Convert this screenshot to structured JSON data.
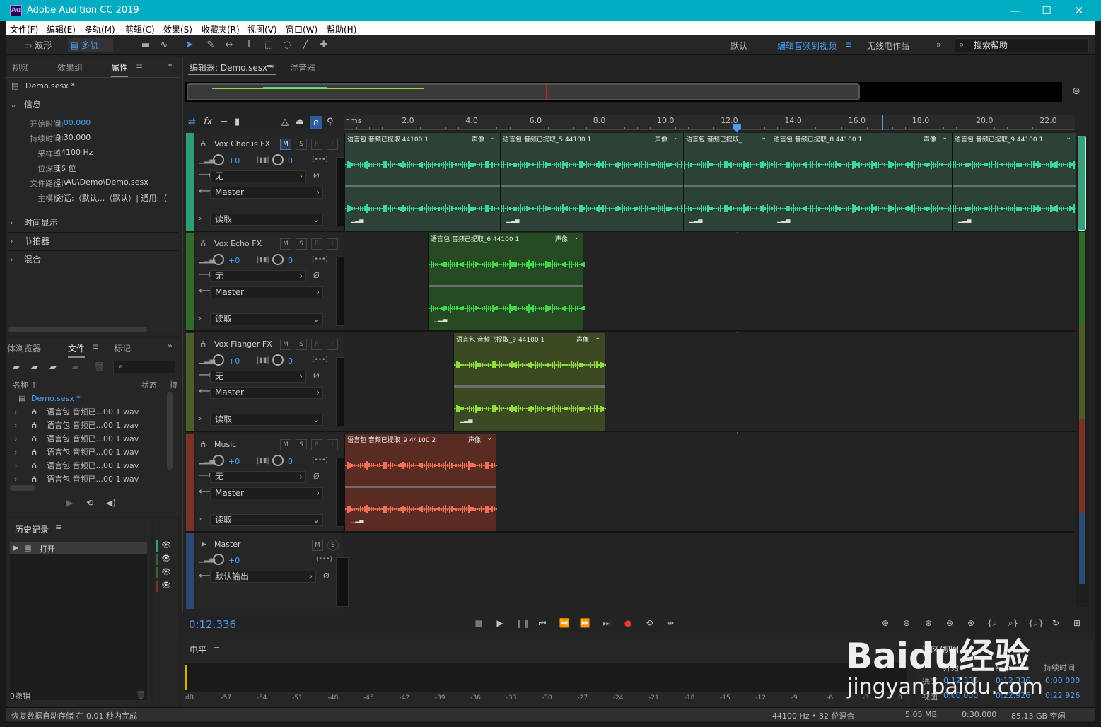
{
  "app": {
    "icon": "Au",
    "title": "Adobe Audition CC 2019"
  },
  "window_controls": {
    "minimize": "—",
    "maximize": "☐",
    "close": "✕"
  },
  "menu": [
    "文件(F)",
    "编辑(E)",
    "多轨(M)",
    "剪辑(C)",
    "效果(S)",
    "收藏夹(R)",
    "视图(V)",
    "窗口(W)",
    "帮助(H)"
  ],
  "toolbar": {
    "waveform": "波形",
    "multitrack": "多轨",
    "workspaces": [
      "默认",
      "编辑音频到视频",
      "无线电作品"
    ],
    "active_workspace_index": 1,
    "more": "»",
    "search_placeholder": "搜索帮助"
  },
  "left_panel": {
    "tabs": [
      "视频",
      "效果组",
      "属性"
    ],
    "active_tab": "属性",
    "more": "»",
    "file_title": "Demo.sesx *",
    "info_section": "信息",
    "info": [
      {
        "label": "开始时间:",
        "value": "0:00.000"
      },
      {
        "label": "持续时间:",
        "value": "0:30.000"
      },
      {
        "label": "采样率:",
        "value": "44100 Hz"
      },
      {
        "label": "位深度:",
        "value": "16 位"
      },
      {
        "label": "文件路径:",
        "value": "E:\\AU\\Demo\\Demo.sesx"
      },
      {
        "label": "主模板:",
        "value": "对话:（默认...（默认）| 通用:（"
      }
    ],
    "sections": [
      "时间显示",
      "节拍器",
      "混合"
    ]
  },
  "files_panel": {
    "tabs": [
      "体浏览器",
      "文件",
      "标记"
    ],
    "active_tab": "文件",
    "more": "»",
    "search_icon": "⌕",
    "col_name": "名称 ↑",
    "col_status": "状态",
    "col_extra": "持",
    "items": [
      "Demo.sesx *",
      "语言包 音频已...00 1.wav",
      "语言包 音频已...00 1.wav",
      "语言包 音频已...00 1.wav",
      "语言包 音频已...00 1.wav",
      "语言包 音频已...00 1.wav",
      "语言包 音频已...00 1.wav"
    ]
  },
  "history_panel": {
    "title": "历史记录",
    "items": [
      "打开"
    ],
    "undo": "0撤销"
  },
  "editor": {
    "tabs": [
      "编辑器: Demo.sesx *",
      "混音器"
    ],
    "ruler_label": "hms",
    "ruler_ticks": [
      "2.0",
      "4.0",
      "6.0",
      "8.0",
      "10.0",
      "12.0",
      "14.0",
      "16.0",
      "18.0",
      "20.0",
      "22.0"
    ],
    "playhead_time": 12.336,
    "tracks": [
      {
        "name": "Vox Chorus FX",
        "vol": "+0",
        "pan": "0",
        "input": "无",
        "output": "Master",
        "mode": "读取",
        "color": "#2e9e76",
        "clips": [
          {
            "label": "语言包 音频已提取 44100 1",
            "mono": "声像",
            "start": 0,
            "end": 4.88,
            "wave": "#3dd69a",
            "bg": "#2d4236"
          },
          {
            "label": "语言包 音频已提取_5 44100 1",
            "mono": "声像",
            "start": 4.88,
            "end": 10.62,
            "wave": "#3dd69a",
            "bg": "#2d4236"
          },
          {
            "label": "语言包 音频已提取_...",
            "mono": "",
            "start": 10.62,
            "end": 13.36,
            "wave": "#3dd69a",
            "bg": "#2d4236"
          },
          {
            "label": "语言包 音频已提取_8 44100 1",
            "mono": "声像",
            "start": 13.36,
            "end": 19.04,
            "wave": "#3dd69a",
            "bg": "#2d4236"
          },
          {
            "label": "语言包 音频已提取_9 44100 1",
            "mono": "",
            "start": 19.04,
            "end": 22.93,
            "wave": "#3dd69a",
            "bg": "#2d4236"
          }
        ]
      },
      {
        "name": "Vox Echo FX",
        "vol": "+0",
        "pan": "0",
        "input": "无",
        "output": "Master",
        "mode": "读取",
        "color": "#2f6b2a",
        "clips": [
          {
            "label": "语言包 音频已提取_6 44100 1",
            "mono": "声像",
            "start": 2.62,
            "end": 7.49,
            "wave": "#3fd64a",
            "bg": "#264a22"
          }
        ]
      },
      {
        "name": "Vox Flanger FX",
        "vol": "+0",
        "pan": "0",
        "input": "无",
        "output": "Master",
        "mode": "读取",
        "color": "#4d5c2a",
        "clips": [
          {
            "label": "语言包 音频已提取_9 44100 1",
            "mono": "声像",
            "start": 3.42,
            "end": 8.16,
            "wave": "#8fdc3a",
            "bg": "#3b4a22"
          }
        ]
      },
      {
        "name": "Music",
        "vol": "+0",
        "pan": "0",
        "input": "无",
        "output": "Master",
        "mode": "读取",
        "color": "#7a3226",
        "clips": [
          {
            "label": "语言包 音频已提取_9 44100 2",
            "mono": "声像",
            "start": 0,
            "end": 4.77,
            "wave": "#f07055",
            "bg": "#5a2b22"
          }
        ]
      }
    ],
    "master": {
      "name": "Master",
      "vol": "+0",
      "output": "默认输出"
    },
    "timecode": "0:12.336"
  },
  "track_buttons": {
    "m": "M",
    "s": "S",
    "r": "R",
    "i": "I"
  },
  "levels": {
    "title": "电平",
    "db": [
      "dB",
      "-57",
      "-54",
      "-51",
      "-48",
      "-45",
      "-42",
      "-39",
      "-36",
      "-33",
      "-30",
      "-27",
      "-24",
      "-21",
      "-18",
      "-15",
      "-12",
      "-9",
      "-6",
      "-3",
      "0"
    ]
  },
  "selection": {
    "title": "选区/视图",
    "headers": [
      "开始",
      "结束",
      "持续时间"
    ],
    "sel_label": "选区",
    "sel": [
      "0:12.336",
      "0:12.336",
      "0:00.000"
    ],
    "view_label": "视图",
    "view": [
      "0:00.000",
      "0:22.926",
      "0:22.926"
    ]
  },
  "status": {
    "left": "恢复数据自动存储 在 0.01 秒内完成",
    "format": "44100 Hz • 32 位混合",
    "size": "5.05 MB",
    "duration": "0:30.000",
    "free": "85.13 GB 空闲"
  },
  "watermark": {
    "brand": "Baidu经验",
    "url": "jingyan.baidu.com"
  }
}
